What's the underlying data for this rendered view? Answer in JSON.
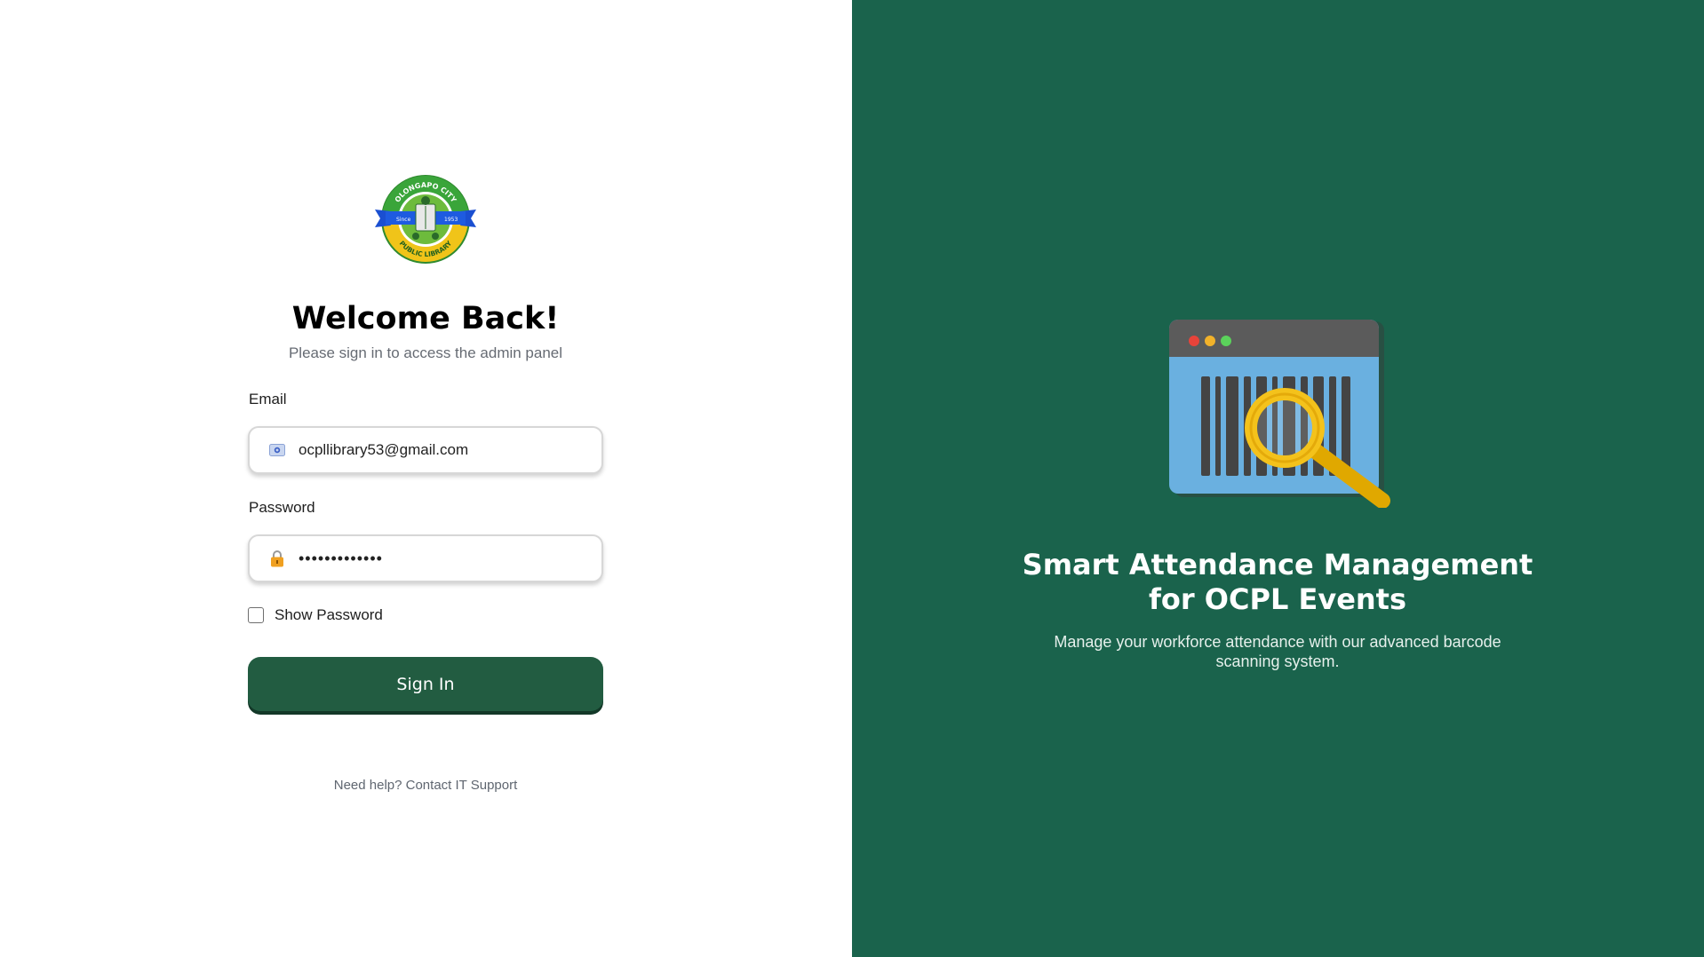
{
  "logo": {
    "top_text": "OLONGAPO CITY",
    "bottom_text": "PUBLIC LIBRARY",
    "since_label": "Since",
    "year": "1953"
  },
  "login": {
    "title": "Welcome Back!",
    "subtitle": "Please sign in to access the admin panel",
    "email_label": "Email",
    "email_value": "ocpllibrary53@gmail.com",
    "email_icon": "envelope-icon",
    "password_label": "Password",
    "password_value": "•••••••••••••",
    "password_icon": "lock-icon",
    "show_password_label": "Show Password",
    "show_password_checked": false,
    "signin_label": "Sign In",
    "help_text": "Need help? Contact IT Support"
  },
  "hero": {
    "title": "Smart Attendance Management for OCPL Events",
    "description": "Manage your workforce attendance with our advanced barcode scanning system.",
    "illustration_icon": "barcode-scanner-icon"
  },
  "colors": {
    "brand_green": "#1a634c",
    "button_green": "#225c41"
  }
}
